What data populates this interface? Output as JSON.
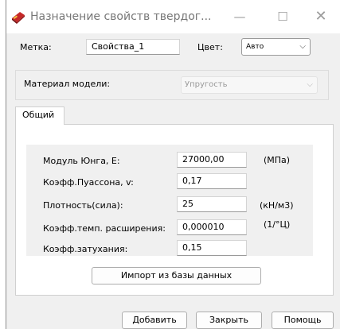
{
  "window": {
    "title": "Назначение свойств твердог...",
    "minimize_glyph": "—",
    "maximize_glyph": "☐",
    "close_glyph": "✕"
  },
  "top": {
    "label_label": "Метка:",
    "label_value": "Свойства_1",
    "color_label": "Цвет:",
    "color_value": "Авто",
    "color_chevron": "⌵"
  },
  "material": {
    "label": "Материал модели:",
    "value": "Упругость",
    "chevron": "⌵"
  },
  "tabs": {
    "general": "Общий"
  },
  "properties": [
    {
      "label": "Модуль Юнга, E:",
      "value": "27000,00",
      "unit": "(МПа)"
    },
    {
      "label": "Коэфф.Пуассона, v:",
      "value": "0,17",
      "unit": ""
    },
    {
      "label": "Плотность(сила):",
      "value": "25",
      "unit": "(кН/м3)"
    },
    {
      "label": "Коэфф.темп. расширения:",
      "value": "0,000010",
      "unit": "(1/°Ц)"
    },
    {
      "label": "Коэфф.затухания:",
      "value": "0,15",
      "unit": ""
    }
  ],
  "buttons": {
    "import": "Импорт из базы данных",
    "add": "Добавить",
    "close": "Закрыть",
    "help": "Помощь"
  }
}
